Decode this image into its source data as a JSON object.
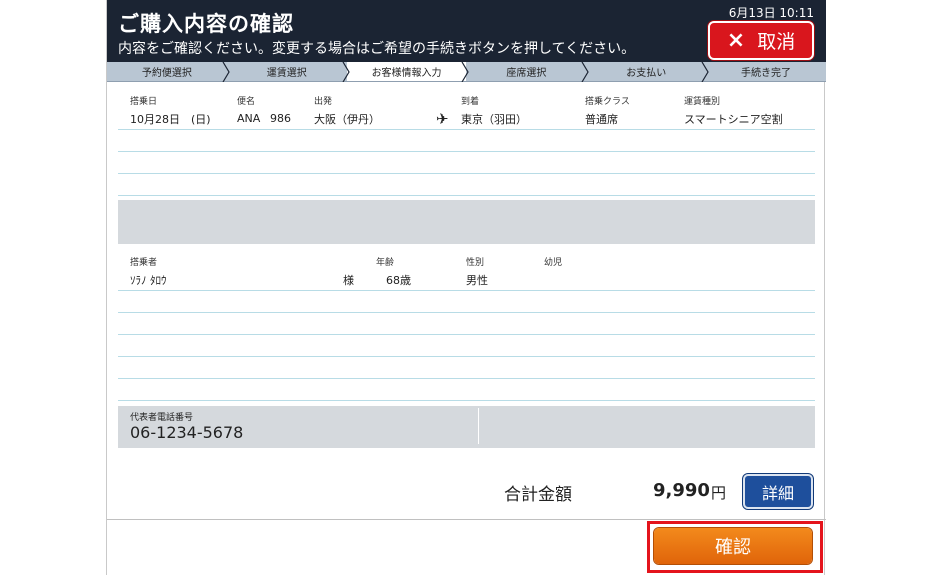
{
  "header": {
    "title": "ご購入内容の確認",
    "subtitle": "内容をご確認ください。変更する場合はご希望の手続きボタンを押してください。",
    "datetime": "6月13日  10:11",
    "cancel_label": "取消",
    "cancel_icon": "×"
  },
  "steps": [
    {
      "label": "予約便選択",
      "active": false
    },
    {
      "label": "運賃選択",
      "active": false
    },
    {
      "label": "お客様情報入力",
      "active": true
    },
    {
      "label": "座席選択",
      "active": false
    },
    {
      "label": "お支払い",
      "active": false
    },
    {
      "label": "手続き完了",
      "active": false
    }
  ],
  "flight": {
    "headers": {
      "date": "搭乗日",
      "flight_no": "便名",
      "departure": "出発",
      "arrival": "到着",
      "class": "搭乗クラス",
      "fare": "運賃種別"
    },
    "row": {
      "date": "10月28日　(日)",
      "airline": "ANA",
      "number": "986",
      "departure": "大阪（伊丹）",
      "plane_icon": "✈",
      "arrival": "東京（羽田）",
      "class": "普通席",
      "fare": "スマートシニア空割"
    }
  },
  "passenger": {
    "headers": {
      "name": "搭乗者",
      "age": "年齢",
      "gender": "性別",
      "infant": "幼児"
    },
    "row": {
      "name": "ｿﾗﾉ ﾀﾛｳ",
      "honorific": "様",
      "age": "68歳",
      "gender": "男性",
      "infant": ""
    }
  },
  "contact": {
    "label": "代表者電話番号",
    "value": "06-1234-5678"
  },
  "total": {
    "label": "合計金額",
    "value": "9,990",
    "unit": "円",
    "detail_label": "詳細"
  },
  "confirm_label": "確認",
  "colors": {
    "header_bg": "#1b2433",
    "cancel_red": "#d9161d",
    "detail_blue": "#1e4f9c",
    "confirm_orange": "#ee7a14",
    "steps_bg": "#b9c6d3",
    "row_line": "#b8dce6"
  }
}
